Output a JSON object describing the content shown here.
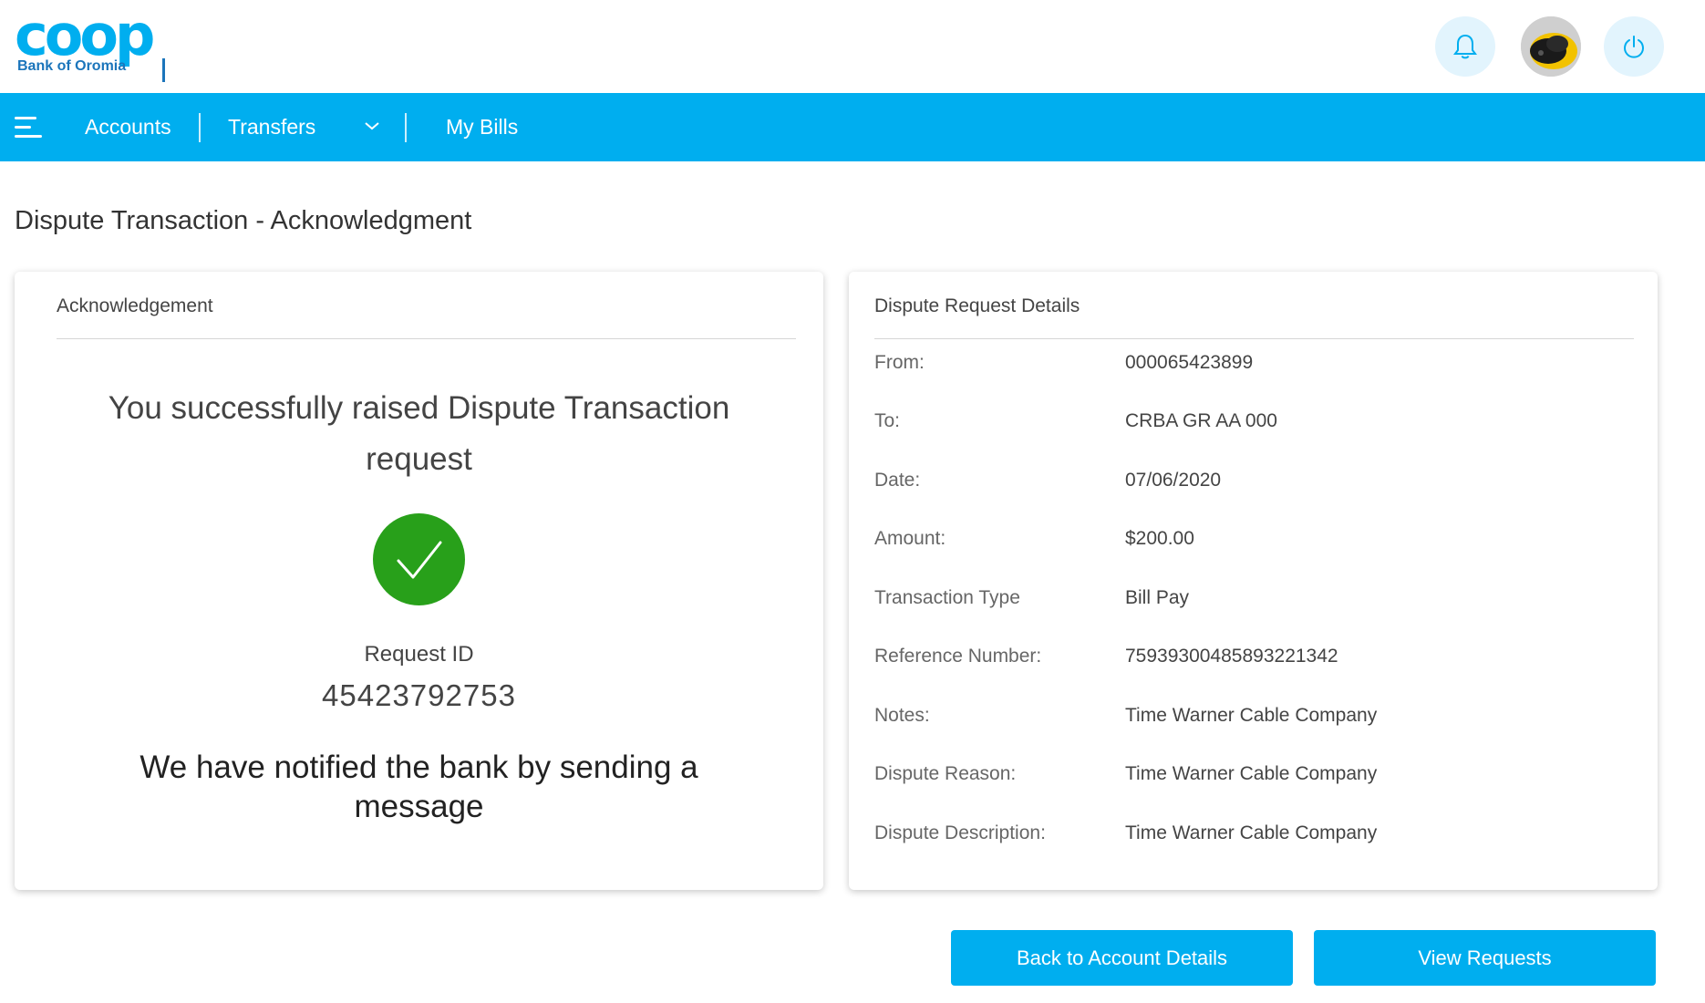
{
  "brand": {
    "logo_word": "coop",
    "logo_subtitle": "Bank of Oromia",
    "accent": "#00aeef",
    "brand_dark": "#1b75bb",
    "success": "#28a01a"
  },
  "header_icons": {
    "bell": "bell-icon",
    "avatar": "user-avatar",
    "power": "power-icon"
  },
  "nav": {
    "menu_icon": "hamburger-menu-icon",
    "items": [
      {
        "label": "Accounts"
      },
      {
        "label": "Transfers",
        "has_dropdown": true
      },
      {
        "label": "My Bills"
      }
    ]
  },
  "page": {
    "title": "Dispute Transaction - Acknowledgment"
  },
  "acknowledgement": {
    "heading": "Acknowledgement",
    "success_message": "You successfully raised Dispute Transaction request",
    "check_icon": "checkmark-icon",
    "request_id_label": "Request ID",
    "request_id": "45423792753",
    "notify_message": "We have notified the bank by sending a message"
  },
  "details": {
    "heading": "Dispute Request Details",
    "rows": [
      {
        "label": "From:",
        "value": "000065423899"
      },
      {
        "label": "To:",
        "value": "CRBA GR AA 000"
      },
      {
        "label": "Date:",
        "value": "07/06/2020"
      },
      {
        "label": "Amount:",
        "value": "$200.00"
      },
      {
        "label": "Transaction Type",
        "value": "Bill Pay"
      },
      {
        "label": "Reference Number:",
        "value": "75939300485893221342"
      },
      {
        "label": "Notes:",
        "value": "Time Warner Cable Company"
      },
      {
        "label": "Dispute Reason:",
        "value": "Time Warner Cable Company"
      },
      {
        "label": "Dispute Description:",
        "value": "Time Warner Cable Company"
      }
    ]
  },
  "actions": {
    "back_label": "Back to Account Details",
    "view_label": "View Requests"
  }
}
